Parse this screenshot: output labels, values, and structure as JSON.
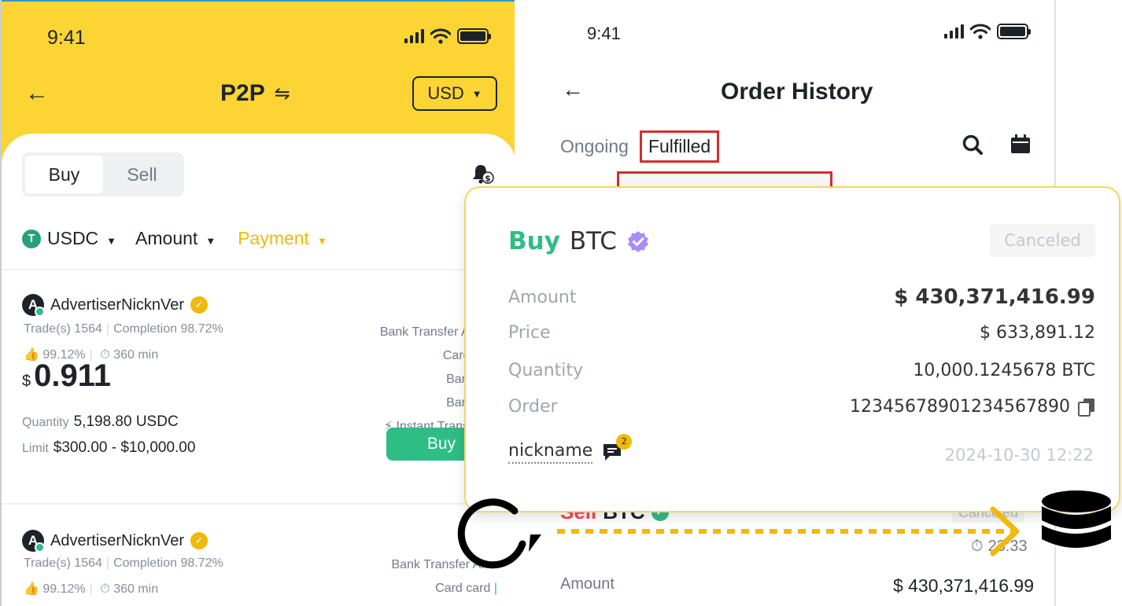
{
  "p2p": {
    "status_time": "9:41",
    "title": "P2P",
    "currency": "USD",
    "tabs": {
      "buy": "Buy",
      "sell": "Sell"
    },
    "filters": {
      "asset": "USDC",
      "amount": "Amount",
      "payment": "Payment"
    },
    "ads": [
      {
        "avatar_letter": "A",
        "name": "AdvertiserNicknVer",
        "trades": "Trade(s) 1564",
        "completion": "Completion 98.72%",
        "rating": "99.12%",
        "time_limit": "360 min",
        "currency_symbol": "$",
        "price": "0.911",
        "quantity_label": "Quantity",
        "quantity": "5,198.80 USDC",
        "limit_label": "Limit",
        "limit": "$300.00 -  $10,000.00",
        "payments": [
          "Bank Transfer Ar",
          "Card c",
          "Bar",
          "Bar",
          "Instant Trans"
        ],
        "buy_label": "Buy"
      },
      {
        "avatar_letter": "A",
        "name": "AdvertiserNicknVer",
        "trades": "Trade(s) 1564",
        "completion": "Completion 98.72%",
        "rating": "99.12%",
        "time_limit": "360 min",
        "payments": [
          "Bank Transfer Arr",
          "Card card"
        ]
      }
    ]
  },
  "orders": {
    "status_time": "9:41",
    "title": "Order History",
    "tabs": {
      "ongoing": "Ongoing",
      "fulfilled": "Fulfilled"
    },
    "card": {
      "side": "Buy",
      "asset": "BTC",
      "status": "Canceled",
      "rows": [
        {
          "label": "Amount",
          "value": "$ 430,371,416.99"
        },
        {
          "label": "Price",
          "value": "$ 633,891.12"
        },
        {
          "label": "Quantity",
          "value": "10,000.1245678 BTC"
        },
        {
          "label": "Order",
          "value": "12345678901234567890"
        }
      ],
      "nickname": "nickname",
      "unread": "2",
      "timestamp": "2024-10-30 12:22"
    },
    "second": {
      "side": "Sell",
      "asset": "BTC",
      "status": "Canceled",
      "timer": "23:33",
      "amount_label": "Amount",
      "amount_value": "$ 430,371,416.99"
    }
  },
  "colors": {
    "brand_yellow": "#fcd535",
    "buy_green": "#2ebd85",
    "sell_red": "#f6465d",
    "highlight_red": "#d32f2f",
    "verified_purple": "#a78bfa"
  }
}
